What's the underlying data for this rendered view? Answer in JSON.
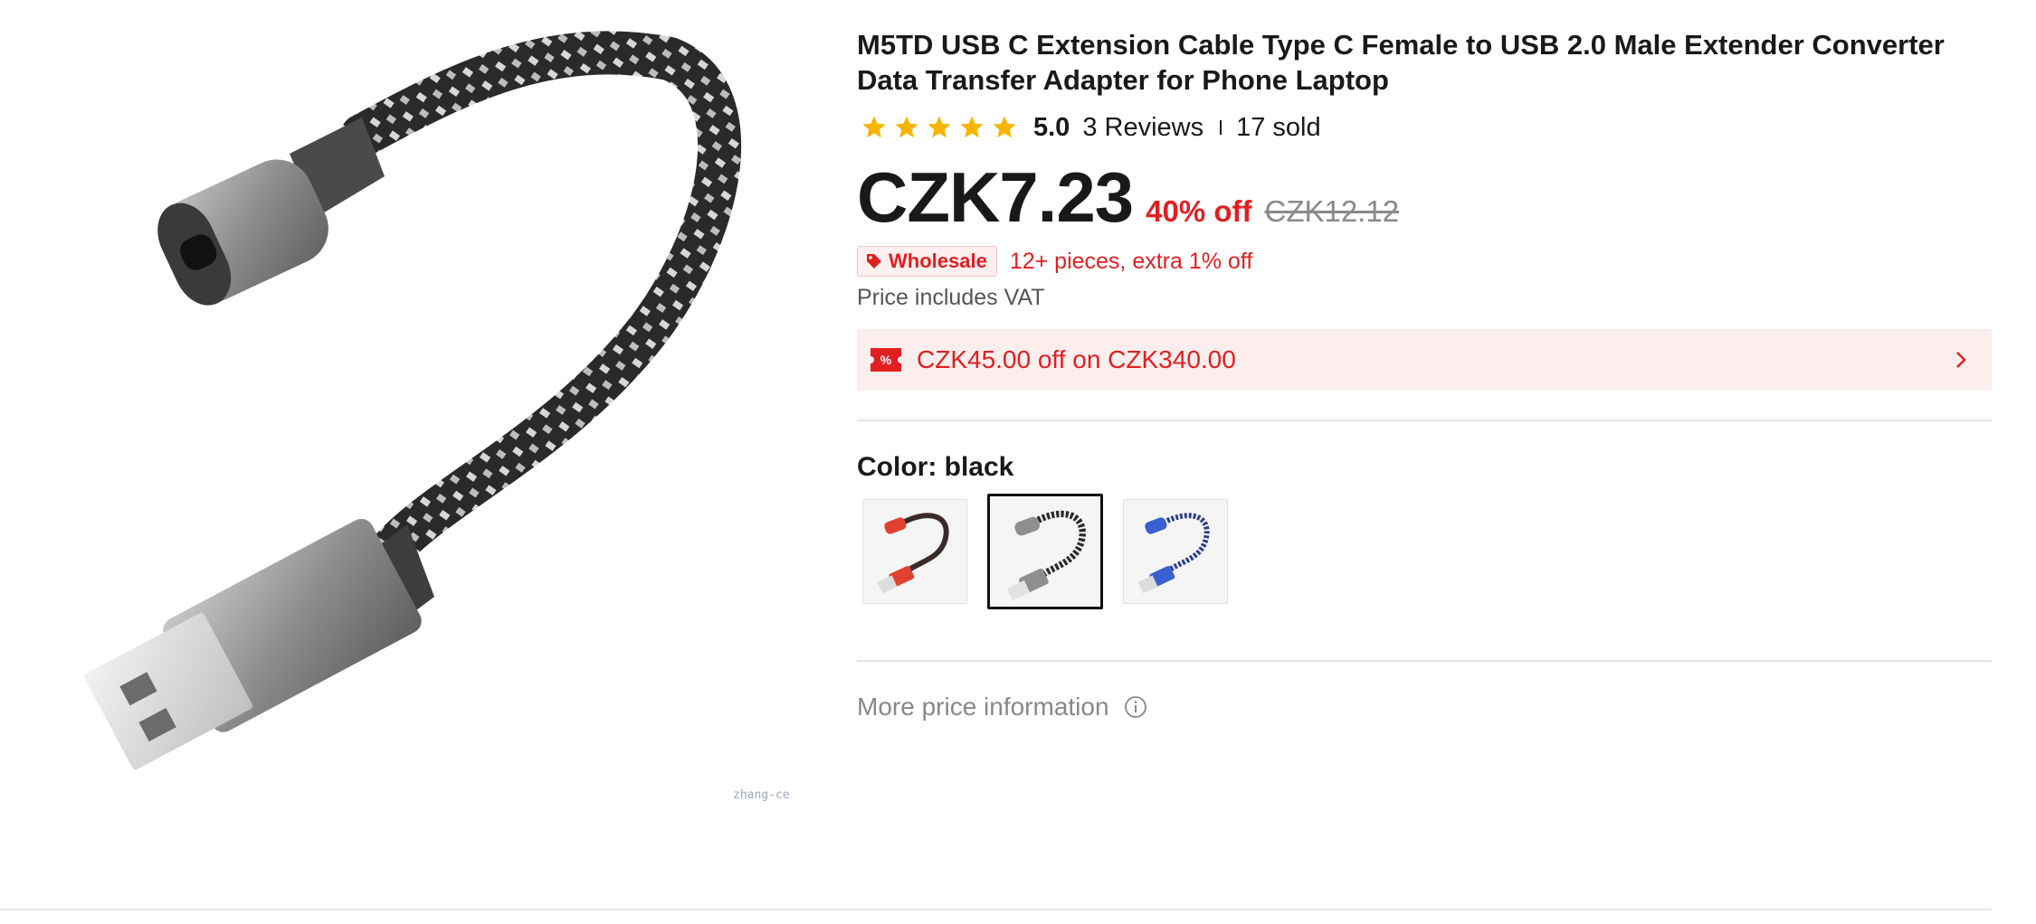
{
  "product": {
    "title": "M5TD USB C Extension Cable Type C Female to USB 2.0 Male Extender Converter Data Transfer Adapter for Phone Laptop",
    "image_watermark": "zhang-ce",
    "rating": {
      "stars": 5,
      "value": "5.0",
      "reviews": "3 Reviews",
      "sold": "17 sold"
    },
    "price": {
      "current": "CZK7.23",
      "discount": "40% off",
      "original": "CZK12.12"
    },
    "wholesale": {
      "badge": "Wholesale",
      "text": "12+ pieces, extra 1% off"
    },
    "vat_note": "Price includes VAT",
    "coupon": {
      "text": "CZK45.00 off on CZK340.00",
      "icon": "coupon-percent-icon"
    },
    "color": {
      "label": "Color: black",
      "selected_index": 1,
      "options": [
        "red",
        "black",
        "blue"
      ]
    },
    "more_price_info": "More price information"
  },
  "colors": {
    "accent_red": "#e02020",
    "star_yellow": "#f7b500",
    "coupon_bg": "#fdeeee",
    "text_dark": "#191919",
    "text_muted": "#888888"
  }
}
